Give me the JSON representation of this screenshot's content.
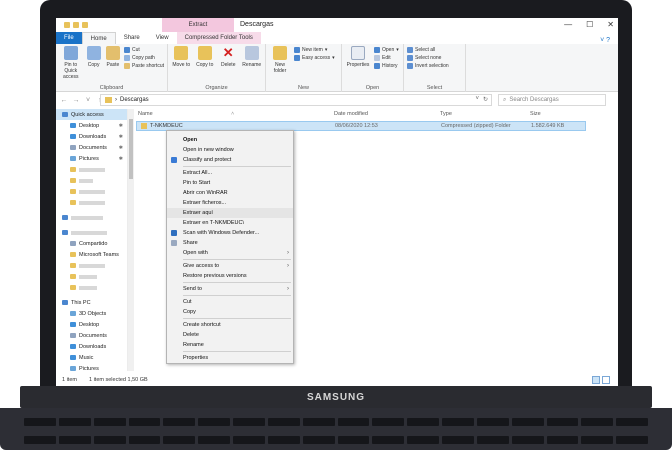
{
  "device": {
    "brand": "SAMSUNG"
  },
  "window": {
    "title": "Descargas",
    "context_group": "Extract",
    "controls": [
      "—",
      "☐",
      "✕"
    ]
  },
  "tabs": [
    {
      "label": "File"
    },
    {
      "label": "Home"
    },
    {
      "label": "Share"
    },
    {
      "label": "View"
    },
    {
      "label": "Compressed Folder Tools"
    }
  ],
  "ribbon": {
    "clipboard": {
      "label": "Clipboard",
      "pin": "Pin to Quick access",
      "copy": "Copy",
      "paste": "Paste",
      "cut": "Cut",
      "copy_path": "Copy path",
      "paste_shortcut": "Paste shortcut"
    },
    "organize": {
      "label": "Organize",
      "move_to": "Move to",
      "copy_to": "Copy to",
      "delete": "Delete",
      "rename": "Rename"
    },
    "new": {
      "label": "New",
      "new_folder": "New folder",
      "new_item": "New item",
      "easy_access": "Easy access"
    },
    "open": {
      "label": "Open",
      "properties": "Properties",
      "open": "Open",
      "edit": "Edit",
      "history": "History"
    },
    "select": {
      "label": "Select",
      "select_all": "Select all",
      "select_none": "Select none",
      "invert": "Invert selection"
    }
  },
  "address": {
    "path": "Descargas",
    "search_placeholder": "Search Descargas"
  },
  "nav_pane": {
    "quick_access": "Quick access",
    "desktop": "Desktop",
    "downloads": "Downloads",
    "documents": "Documents",
    "pictures": "Pictures",
    "shared": "Compartido",
    "teams": "Microsoft Teams",
    "this_pc": "This PC",
    "objects3d": "3D Objects",
    "pc_desktop": "Desktop",
    "pc_documents": "Documents",
    "pc_downloads": "Downloads",
    "music": "Music",
    "pc_pictures": "Pictures"
  },
  "columns": {
    "name": "Name",
    "date": "Date modified",
    "type": "Type",
    "size": "Size"
  },
  "file": {
    "name": "T-NKMDEUC",
    "date": "08/06/2020 12:53",
    "type": "Compressed (zipped) Folder",
    "size": "1.582.649 KB"
  },
  "context_menu": {
    "open": "Open",
    "open_new_window": "Open in new window",
    "classify": "Classify and protect",
    "extract_all": "Extract All...",
    "pin_start": "Pin to Start",
    "open_winrar": "Abrir con WinRAR",
    "extract_files": "Extraer ficheros...",
    "extract_here": "Extraer aquí",
    "extract_to": "Extraer en T-NKMDEUC\\",
    "scan": "Scan with Windows Defender...",
    "share": "Share",
    "open_with": "Open with",
    "give_access": "Give access to",
    "restore": "Restore previous versions",
    "send_to": "Send to",
    "cut": "Cut",
    "copy": "Copy",
    "create_shortcut": "Create shortcut",
    "delete": "Delete",
    "rename": "Rename",
    "properties": "Properties"
  },
  "status": {
    "count": "1 item",
    "selected": "1 item selected  1,50 GB"
  },
  "colors": {
    "accent": "#1a73c8",
    "selection": "#cce4f7",
    "context_tab": "#f3c7de",
    "folder": "#e8c25a"
  }
}
